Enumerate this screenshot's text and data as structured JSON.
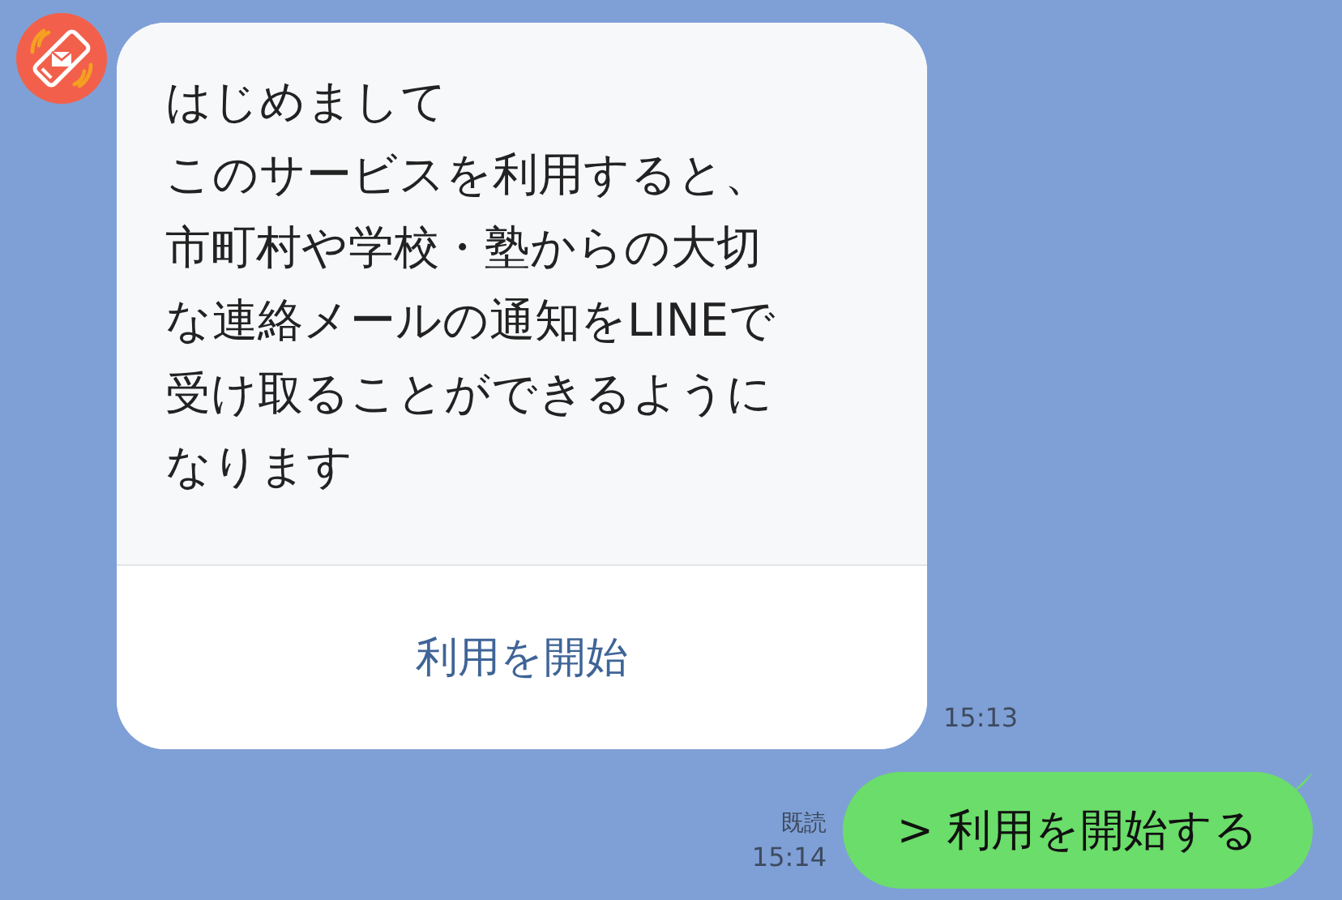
{
  "messages": [
    {
      "kind": "card",
      "lines": [
        "はじめまして",
        "このサービスを利用すると、",
        "市町村や学校・塾からの大切",
        "な連絡メールの通知をLINEで",
        "受け取ることができるように",
        "なります"
      ],
      "action": "利用を開始",
      "time": "15:13"
    },
    {
      "kind": "text",
      "text": "> 利用を開始する",
      "read": "既読",
      "time": "15:14"
    }
  ]
}
